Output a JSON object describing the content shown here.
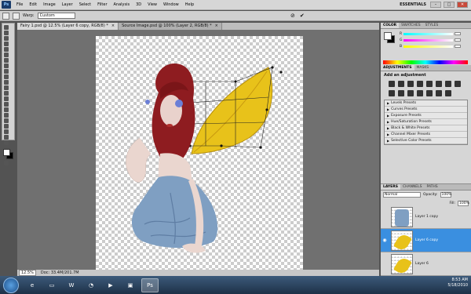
{
  "menubar": {
    "logo": "Ps",
    "items": [
      "File",
      "Edit",
      "Image",
      "Layer",
      "Select",
      "Filter",
      "Analysis",
      "3D",
      "View",
      "Window",
      "Help"
    ],
    "workspace": "ESSENTIALS",
    "window_buttons": [
      "–",
      "□",
      "✕"
    ]
  },
  "options": {
    "warp_label": "Warp:",
    "warp_value": "Custom",
    "cancel_icon": "⊘",
    "commit_icon": "✔"
  },
  "tabs": [
    {
      "label": "Fairy 1.psd @ 12.5% (Layer 6 copy, RGB/8) *",
      "active": true
    },
    {
      "label": "Source Image.psd @ 100% (Layer 2, RGB/8) *",
      "active": false
    }
  ],
  "status": {
    "zoom": "12.5%",
    "doc": "Doc: 33.4M/201.7M"
  },
  "color_panel": {
    "tabs": [
      "COLOR",
      "SWATCHES",
      "STYLES"
    ],
    "channels": [
      "R",
      "G",
      "B"
    ]
  },
  "adjustments": {
    "tabs": [
      "ADJUSTMENTS",
      "MASKS"
    ],
    "title": "Add an adjustment",
    "presets": [
      "Levels Presets",
      "Curves Presets",
      "Exposure Presets",
      "Hue/Saturation Presets",
      "Black & White Presets",
      "Channel Mixer Presets",
      "Selective Color Presets"
    ]
  },
  "layers": {
    "tabs": [
      "LAYERS",
      "CHANNELS",
      "PATHS"
    ],
    "blend_mode": "Normal",
    "opacity_label": "Opacity:",
    "opacity": "100%",
    "fill_label": "Fill:",
    "fill": "100%",
    "items": [
      {
        "name": "Layer 1 copy",
        "selected": false
      },
      {
        "name": "Layer 6 copy",
        "selected": true
      },
      {
        "name": "Layer 6",
        "selected": false
      }
    ]
  },
  "taskbar": {
    "time": "8:53 AM",
    "date": "5/18/2010"
  },
  "colors": {
    "accent_selected": "#3a8fe0",
    "wing_yellow": "#e8c21a",
    "hair_red": "#8e1c20",
    "dress_blue": "#7f9fc2"
  }
}
